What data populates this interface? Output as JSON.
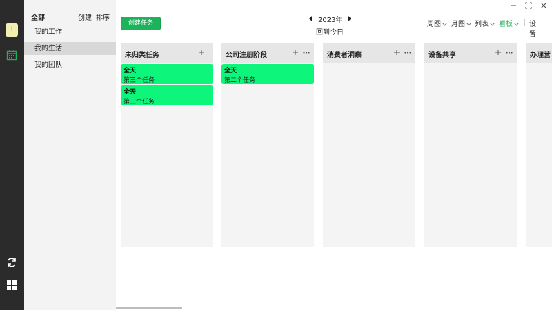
{
  "rail": {
    "avatar_text": "!"
  },
  "side": {
    "all_label": "全部",
    "create_label": "创建",
    "sort_label": "排序",
    "items": [
      {
        "label": "我的工作"
      },
      {
        "label": "我的生活"
      },
      {
        "label": "我的团队"
      }
    ],
    "active_index": 1
  },
  "toolbar": {
    "create_task": "创建任务",
    "year": "2023年",
    "today": "回到今日",
    "views": [
      "周图",
      "月图",
      "列表",
      "看板"
    ],
    "active_view": "看板",
    "settings": "设置"
  },
  "board": {
    "columns": [
      {
        "title": "未归类任务",
        "cards": [
          {
            "tag": "全天",
            "title": "第三个任务"
          },
          {
            "tag": "全天",
            "title": "第三个任务"
          }
        ]
      },
      {
        "title": "公司注册阶段",
        "cards": [
          {
            "tag": "全天",
            "title": "第二个任务"
          }
        ]
      },
      {
        "title": "消费者洞察",
        "cards": []
      },
      {
        "title": "设备共享",
        "cards": []
      },
      {
        "title": "办理营",
        "cards": []
      }
    ]
  },
  "colors": {
    "accent": "#1db35b",
    "card": "#0df57a",
    "rail": "#2b2b2b"
  }
}
